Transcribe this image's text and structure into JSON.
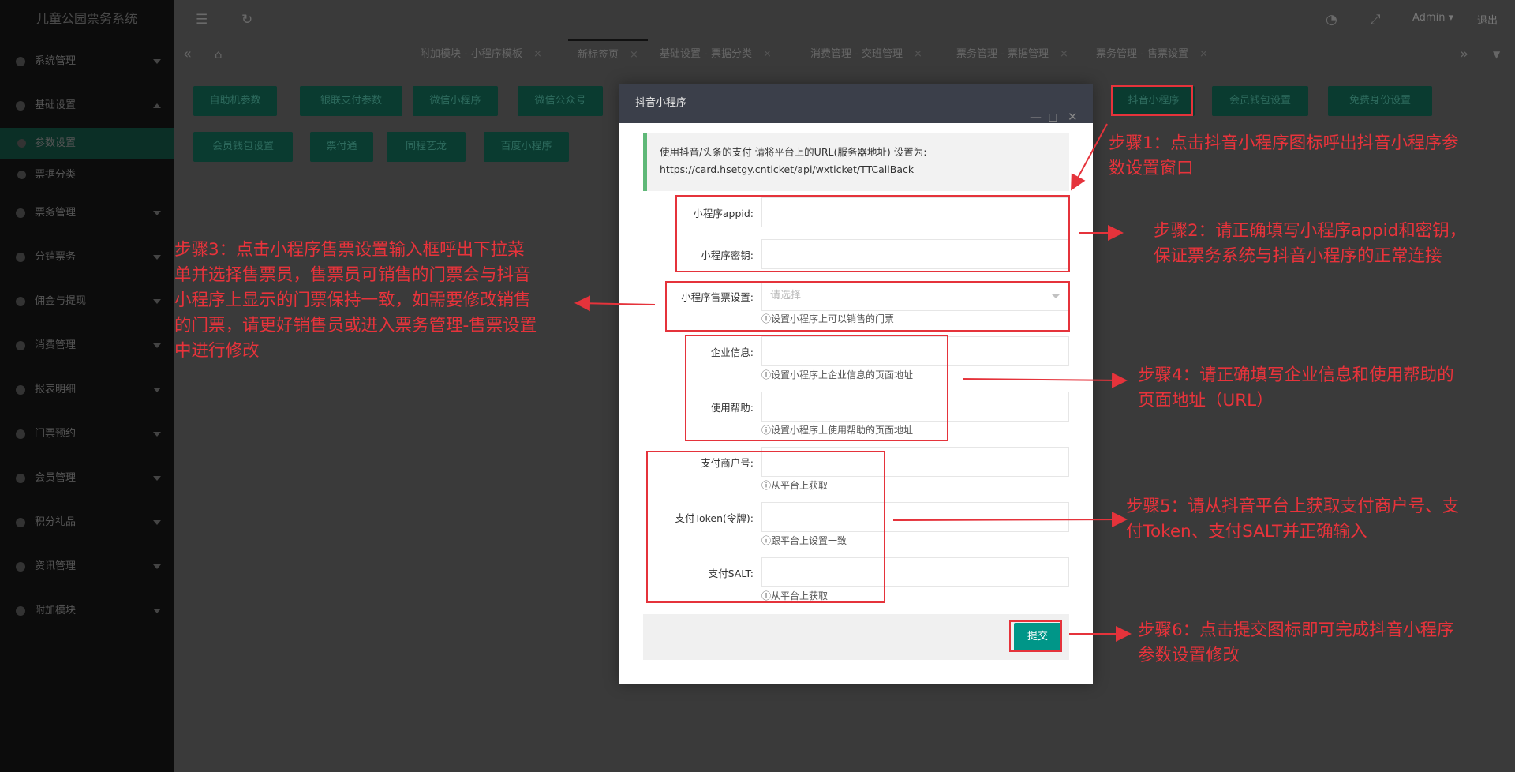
{
  "app": {
    "title": "儿童公园票务系统"
  },
  "sidebar": {
    "items": [
      {
        "label": "系统管理",
        "expanded": false
      },
      {
        "label": "基础设置",
        "expanded": true
      },
      {
        "label": "参数设置",
        "sub": true,
        "active": true
      },
      {
        "label": "票据分类",
        "sub": true
      },
      {
        "label": "票务管理",
        "expanded": false
      },
      {
        "label": "分销票务",
        "expanded": false
      },
      {
        "label": "佣金与提现",
        "expanded": false
      },
      {
        "label": "消费管理",
        "expanded": false
      },
      {
        "label": "报表明细",
        "expanded": false
      },
      {
        "label": "门票预约",
        "expanded": false
      },
      {
        "label": "会员管理",
        "expanded": false
      },
      {
        "label": "积分礼品",
        "expanded": false
      },
      {
        "label": "资讯管理",
        "expanded": false
      },
      {
        "label": "附加模块",
        "expanded": false
      }
    ]
  },
  "topbar": {
    "user": "Admin",
    "logout": "退出",
    "icons": [
      "menu-fold-icon",
      "refresh-icon",
      "theme-icon",
      "fullscreen-icon"
    ]
  },
  "tabs": [
    {
      "label": "附加模块 - 小程序模板"
    },
    {
      "label": "新标签页",
      "active": true
    },
    {
      "label": "基础设置 - 票据分类"
    },
    {
      "label": "消费管理 - 交班管理"
    },
    {
      "label": "票务管理 - 票据管理"
    },
    {
      "label": "票务管理 - 售票设置"
    }
  ],
  "page_buttons": {
    "row1": [
      "自助机参数",
      "银联支付参数",
      "微信小程序",
      "微信公众号",
      "抖音小程序",
      "会员钱包设置",
      "免费身份设置"
    ],
    "row2": [
      "会员钱包设置",
      "票付通",
      "同程艺龙",
      "百度小程序"
    ]
  },
  "modal": {
    "title": "抖音小程序",
    "notice_line1": "使用抖音/头条的支付 请将平台上的URL(服务器地址) 设置为:",
    "notice_line2": "https://card.hsetgy.cnticket/api/wxticket/TTCallBack",
    "fields": {
      "appid_label": "小程序appid:",
      "secret_label": "小程序密钥:",
      "sale_label": "小程序售票设置:",
      "sale_placeholder": "请选择",
      "sale_hint": "ⓘ设置小程序上可以销售的门票",
      "company_label": "企业信息:",
      "company_hint": "ⓘ设置小程序上企业信息的页面地址",
      "help_label": "使用帮助:",
      "help_hint": "ⓘ设置小程序上使用帮助的页面地址",
      "merchant_label": "支付商户号:",
      "merchant_hint": "ⓘ从平台上获取",
      "token_label": "支付Token(令牌):",
      "token_hint": "ⓘ跟平台上设置一致",
      "salt_label": "支付SALT:",
      "salt_hint": "ⓘ从平台上获取"
    },
    "submit": "提交"
  },
  "annotations": {
    "step1": "步骤1：点击抖音小程序图标呼出抖音小程序参数设置窗口",
    "step1_l1": "步骤1：点击抖音小程序图标呼出抖音小程序参",
    "step1_l2": "数设置窗口",
    "step2_l1": "步骤2：请正确填写小程序appid和密钥，",
    "step2_l2": "保证票务系统与抖音小程序的正常连接",
    "step3_l1": "步骤3：点击小程序售票设置输入框呼出下拉菜",
    "step3_l2": "单并选择售票员，售票员可销售的门票会与抖音",
    "step3_l3": "小程序上显示的门票保持一致，如需要修改销售",
    "step3_l4": "的门票，请更好销售员或进入票务管理-售票设置",
    "step3_l5": "中进行修改",
    "step4_l1": "步骤4：请正确填写企业信息和使用帮助的",
    "step4_l2": "页面地址（URL）",
    "step5_l1": "步骤5：请从抖音平台上获取支付商户号、支",
    "step5_l2": "付Token、支付SALT并正确输入",
    "step6_l1": "步骤6：点击提交图标即可完成抖音小程序",
    "step6_l2": "参数设置修改",
    "color": "#e5333b"
  }
}
